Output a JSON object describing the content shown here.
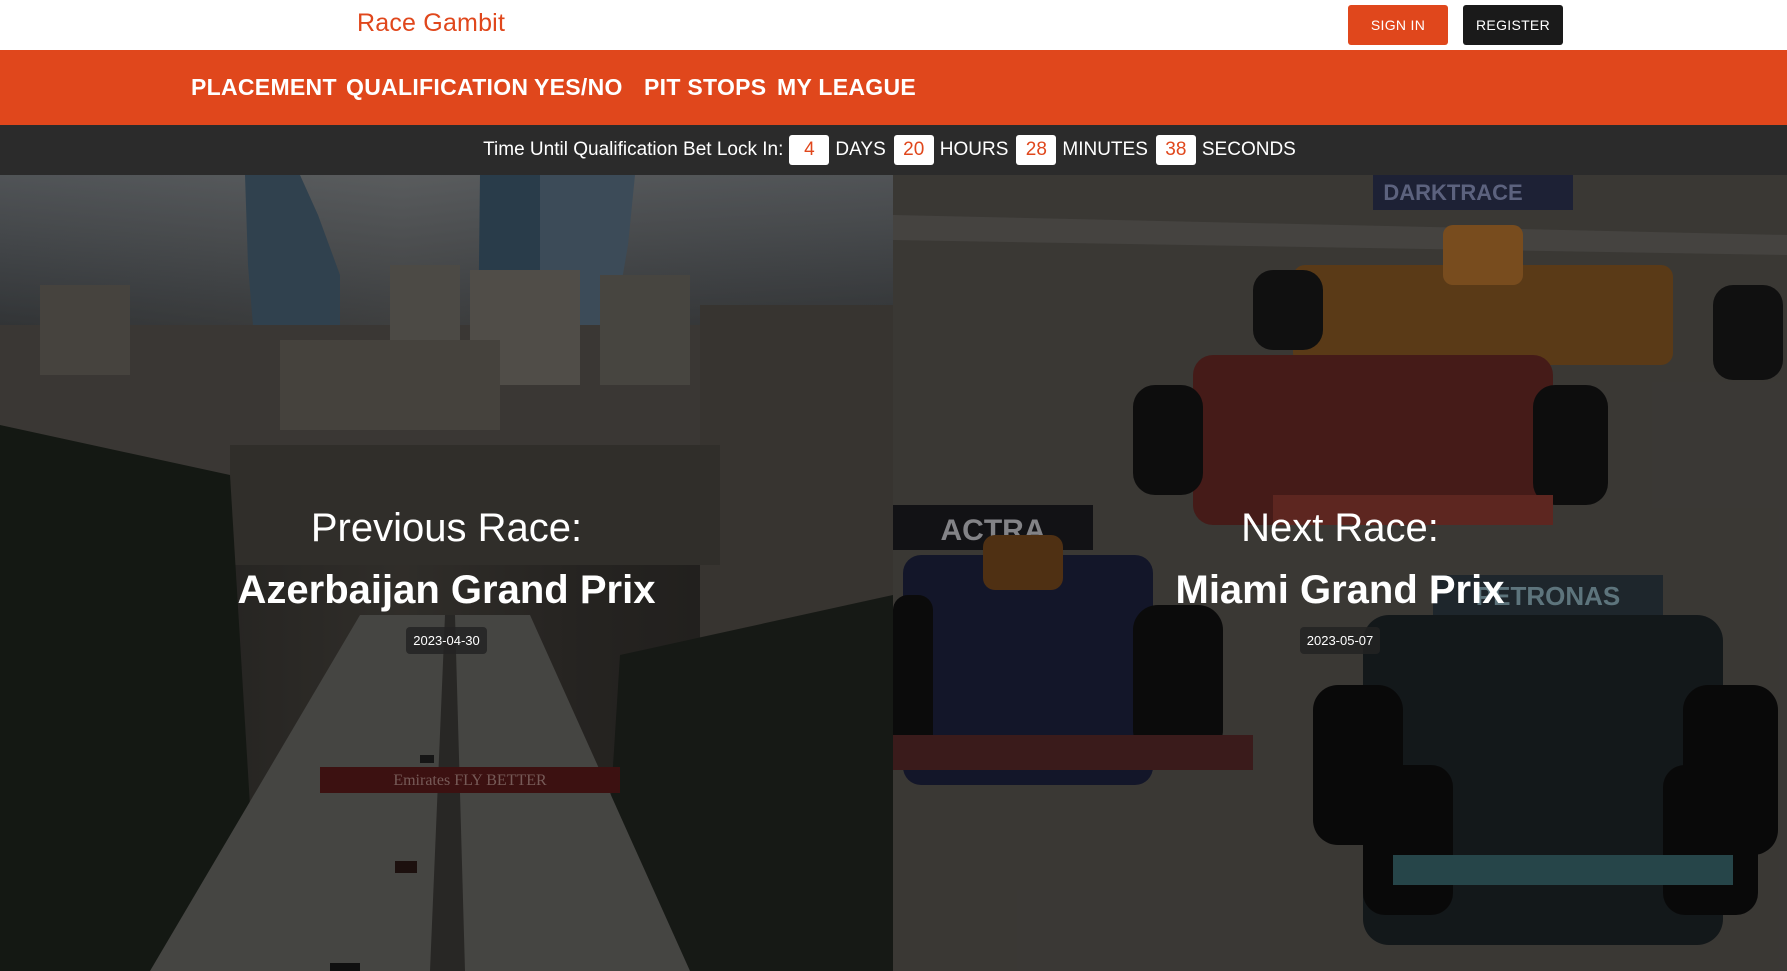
{
  "header": {
    "brand": "Race Gambit",
    "sign_in": "SIGN IN",
    "register": "REGISTER"
  },
  "nav": {
    "items": [
      {
        "label": "PLACEMENT"
      },
      {
        "label": "QUALIFICATION"
      },
      {
        "label": "YES/NO"
      },
      {
        "label": "PIT STOPS"
      },
      {
        "label": "MY LEAGUE"
      }
    ]
  },
  "countdown": {
    "label": "Time Until Qualification Bet Lock In:",
    "days": "4",
    "days_unit": "DAYS",
    "hours": "20",
    "hours_unit": "HOURS",
    "minutes": "28",
    "minutes_unit": "MINUTES",
    "seconds": "38",
    "seconds_unit": "SECONDS"
  },
  "previous_race": {
    "kicker": "Previous Race:",
    "name": "Azerbaijan Grand Prix",
    "date": "2023-04-30",
    "banner_text": "Emirates FLY BETTER"
  },
  "next_race": {
    "kicker": "Next Race:",
    "name": "Miami Grand Prix",
    "date": "2023-05-07",
    "sponsor_text_1": "ACTRA",
    "sponsor_text_2": "PETRONAS",
    "sponsor_text_3": "DARKTRACE"
  },
  "colors": {
    "accent": "#e0471c",
    "dark": "#2b2b2b"
  }
}
